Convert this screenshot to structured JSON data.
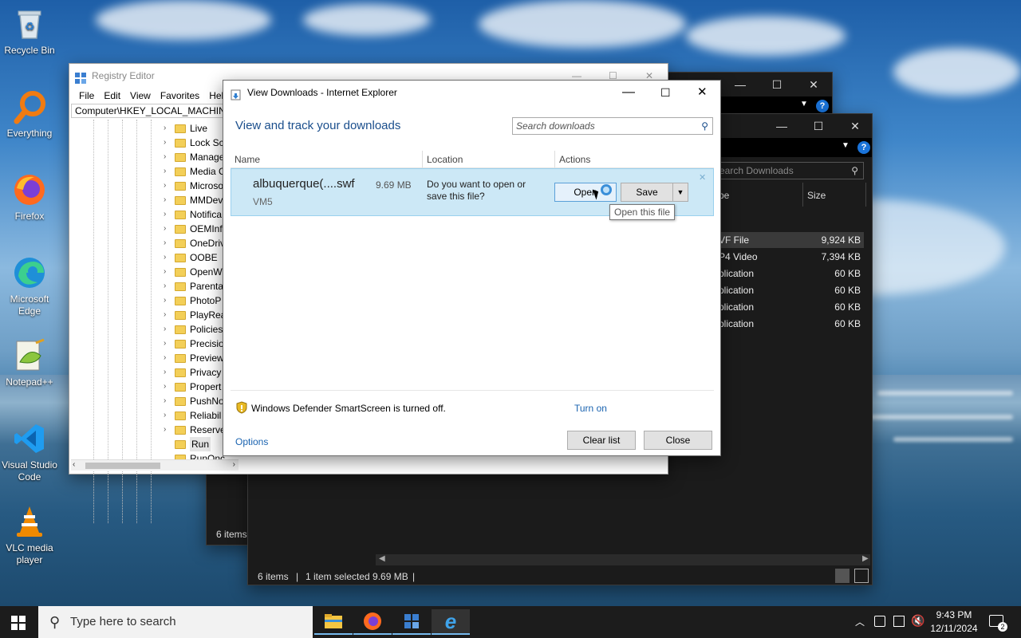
{
  "desktop": {
    "icons": [
      {
        "label": "Recycle Bin"
      },
      {
        "label": "Everything"
      },
      {
        "label": "Firefox"
      },
      {
        "label": "Microsoft Edge"
      },
      {
        "label": "Notepad++"
      },
      {
        "label": "Visual Studio Code"
      },
      {
        "label": "VLC media player"
      }
    ]
  },
  "registry": {
    "title": "Registry Editor",
    "menu": [
      "File",
      "Edit",
      "View",
      "Favorites",
      "Help"
    ],
    "address": "Computer\\HKEY_LOCAL_MACHINE",
    "tree": [
      "Live",
      "Lock Sc",
      "Manage",
      "Media C",
      "Microso",
      "MMDev",
      "Notifica",
      "OEMInf",
      "OneDriv",
      "OOBE",
      "OpenW",
      "Parenta",
      "PhotoP",
      "PlayRea",
      "Policies",
      "Precisio",
      "Preview",
      "Privacy",
      "Propert",
      "PushNo",
      "Reliabil",
      "Reserve",
      "Run",
      "RunOnc"
    ],
    "selected": "Run"
  },
  "explorer": {
    "search_placeholder": "Search Downloads",
    "columns": {
      "type": "pe",
      "size": "Size"
    },
    "rows": [
      {
        "type": "VF File",
        "size": "9,924 KB"
      },
      {
        "type": "P4 Video",
        "size": "7,394 KB"
      },
      {
        "type": "plication",
        "size": "60 KB"
      },
      {
        "type": "plication",
        "size": "60 KB"
      },
      {
        "type": "plication",
        "size": "60 KB"
      },
      {
        "type": "plication",
        "size": "60 KB"
      }
    ],
    "status": {
      "items": "6 items",
      "selected": "1 item selected  9.69 MB"
    },
    "back_status": "6 items"
  },
  "downloads": {
    "title": "View Downloads - Internet Explorer",
    "heading": "View and track your downloads",
    "search_placeholder": "Search downloads",
    "columns": {
      "name": "Name",
      "location": "Location",
      "actions": "Actions"
    },
    "item": {
      "name": "albuquerque(....swf",
      "size": "9.69 MB",
      "source": "VM5",
      "prompt": "Do you want to open or save this file?",
      "open_label": "Open",
      "save_label": "Save"
    },
    "tooltip": "Open this file",
    "smartscreen_text": "Windows Defender SmartScreen is turned off.",
    "turn_on": "Turn on",
    "options": "Options",
    "clear_list": "Clear list",
    "close": "Close"
  },
  "taskbar": {
    "search_placeholder": "Type here to search",
    "time": "9:43 PM",
    "date": "12/11/2024",
    "notifications": "2"
  }
}
